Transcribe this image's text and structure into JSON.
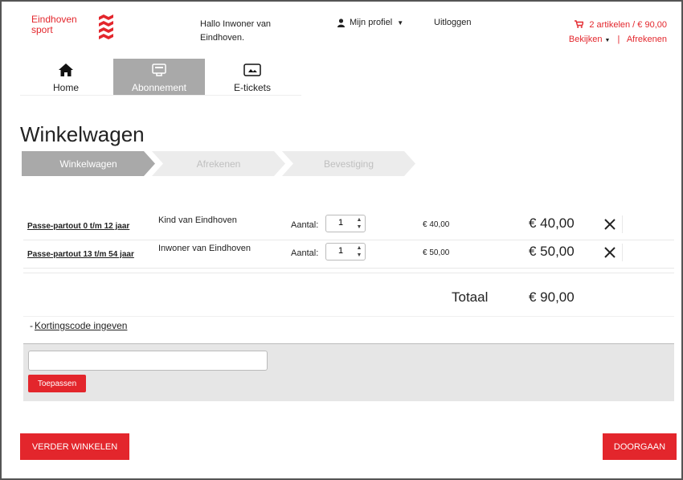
{
  "brand": {
    "line1": "Eindhoven",
    "line2": "sport",
    "accent": "#e3262c"
  },
  "header": {
    "greeting": "Hallo Inwoner van Eindhoven.",
    "profile_label": "Mijn profiel",
    "logout_label": "Uitloggen",
    "cart_summary": "2 artikelen / € 90,00",
    "view_label": "Bekijken",
    "checkout_label": "Afrekenen"
  },
  "tabs": [
    {
      "label": "Home",
      "icon": "home-icon",
      "active": false
    },
    {
      "label": "Abonnement",
      "icon": "card-icon",
      "active": true
    },
    {
      "label": "E-tickets",
      "icon": "ticket-icon",
      "active": false
    }
  ],
  "page": {
    "title": "Winkelwagen"
  },
  "steps": [
    {
      "label": "Winkelwagen",
      "active": true
    },
    {
      "label": "Afrekenen",
      "active": false
    },
    {
      "label": "Bevestiging",
      "active": false
    }
  ],
  "cart": {
    "qty_label": "Aantal:",
    "items": [
      {
        "product": "Passe-partout 0 t/m 12 jaar",
        "description": "Kind van Eindhoven",
        "quantity": "1",
        "unit_price": "€ 40,00",
        "total": "€ 40,00"
      },
      {
        "product": "Passe-partout 13 t/m 54 jaar",
        "description": "Inwoner van Eindhoven",
        "quantity": "1",
        "unit_price": "€ 50,00",
        "total": "€ 50,00"
      }
    ],
    "total_label": "Totaal",
    "total_value": "€ 90,00"
  },
  "discount": {
    "toggle_label": "Kortingscode ingeven",
    "input_value": "",
    "apply_label": "Toepassen"
  },
  "actions": {
    "continue_label": "VERDER WINKELEN",
    "proceed_label": "DOORGAAN"
  }
}
